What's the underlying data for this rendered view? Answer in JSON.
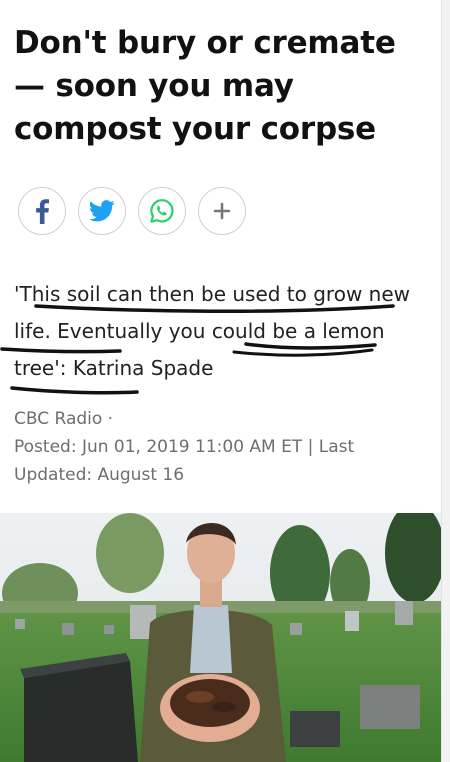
{
  "article": {
    "headline": "Don't bury or cremate — soon you may compost your corpse",
    "quote": "'This soil can then be used to grow new life. Eventually you could be a lemon tree': Katrina Spade",
    "source": "CBC Radio ·",
    "posted": "Posted: Jun 01, 2019 11:00 AM ET | Last",
    "updated": "Updated: August 16"
  },
  "share": {
    "buttons": [
      {
        "icon": "facebook-icon",
        "color": "#3b5998"
      },
      {
        "icon": "twitter-icon",
        "color": "#1da1f2"
      },
      {
        "icon": "whatsapp-icon",
        "color": "#25d366"
      },
      {
        "icon": "plus-icon",
        "color": "#777777"
      }
    ]
  },
  "photo": {
    "subject": "Woman holding composted soil in cupped hands in a cemetery",
    "colors": {
      "grass": "#4f8a3a",
      "sky": "#e8ecef",
      "cardigan": "#5a5a3c",
      "soil": "#4a2c1d"
    }
  },
  "annotations": {
    "ink_color": "#111111",
    "note": "hand-drawn pen underlines over quote"
  }
}
